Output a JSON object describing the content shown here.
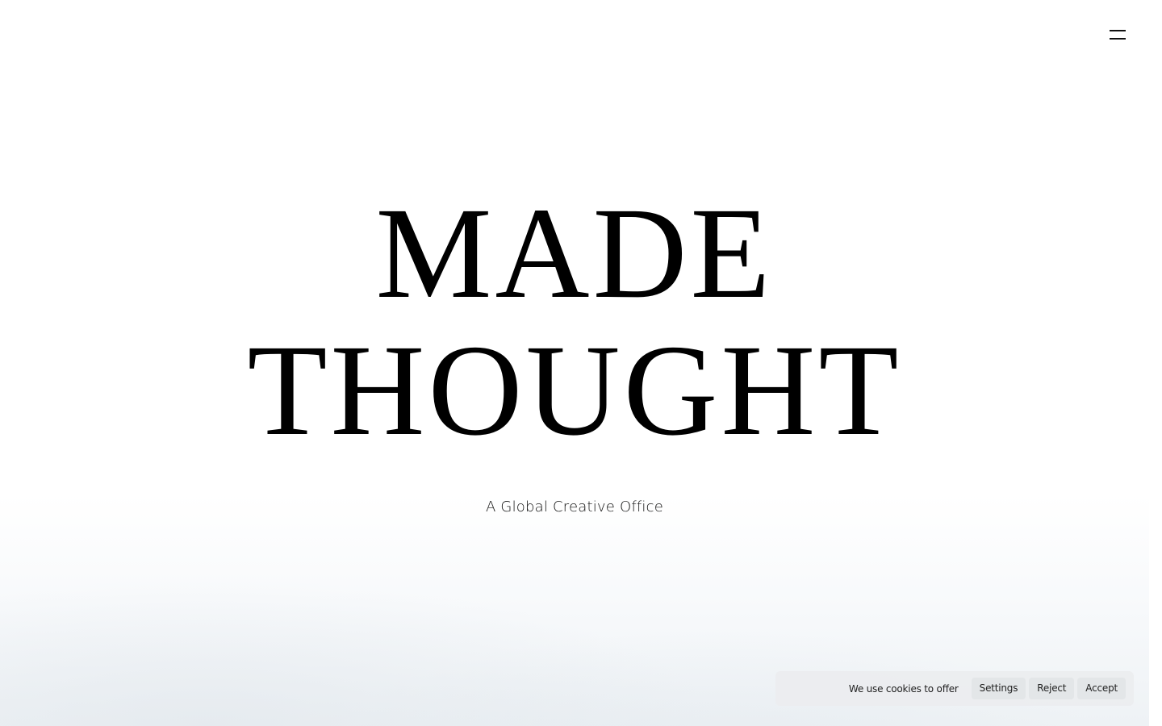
{
  "header": {
    "menu_icon": "hamburger-menu-icon"
  },
  "hero": {
    "brand_line1": "MADE",
    "brand_line2": "THOUGHT",
    "tagline": "A Global Creative Office"
  },
  "cookie_banner": {
    "message": "We use cookies to offer",
    "settings_label": "Settings",
    "reject_label": "Reject",
    "accept_label": "Accept"
  },
  "colors": {
    "text": "#000000",
    "background": "#ffffff",
    "cookie_bar": "#ecedef"
  }
}
